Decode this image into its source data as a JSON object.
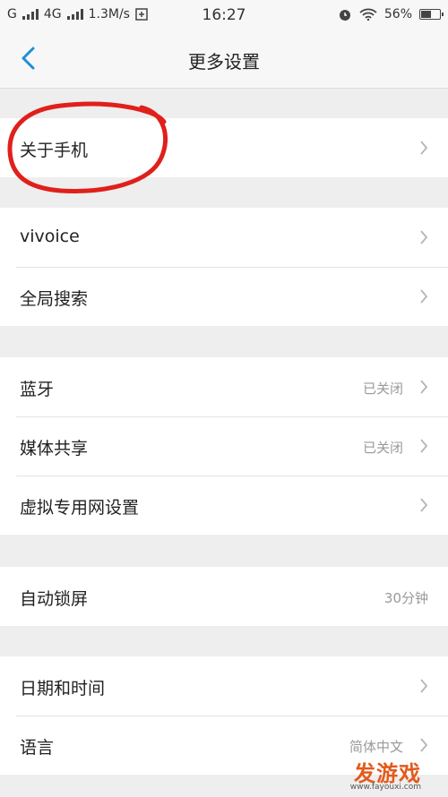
{
  "status_bar": {
    "carrier1": "G",
    "carrier2": "4G",
    "speed": "1.3M/s",
    "time": "16:27",
    "battery_percent": "56%",
    "battery_level": 0.56
  },
  "header": {
    "title": "更多设置"
  },
  "sections": [
    {
      "items": [
        {
          "label": "关于手机"
        }
      ]
    },
    {
      "items": [
        {
          "label": "vivoice"
        },
        {
          "label": "全局搜索"
        }
      ]
    },
    {
      "items": [
        {
          "label": "蓝牙",
          "value": "已关闭"
        },
        {
          "label": "媒体共享",
          "value": "已关闭"
        },
        {
          "label": "虚拟专用网设置"
        }
      ]
    },
    {
      "items": [
        {
          "label": "自动锁屏",
          "value": "30分钟"
        }
      ]
    },
    {
      "items": [
        {
          "label": "日期和时间"
        },
        {
          "label": "语言",
          "value": "简体中文"
        }
      ]
    }
  ],
  "annotation": {
    "color": "#e0201b"
  },
  "watermark": {
    "main": "发游戏",
    "sub": "www.fayouxi.com"
  },
  "colors": {
    "accent": "#1e8fd6",
    "background": "#eeeeee"
  }
}
